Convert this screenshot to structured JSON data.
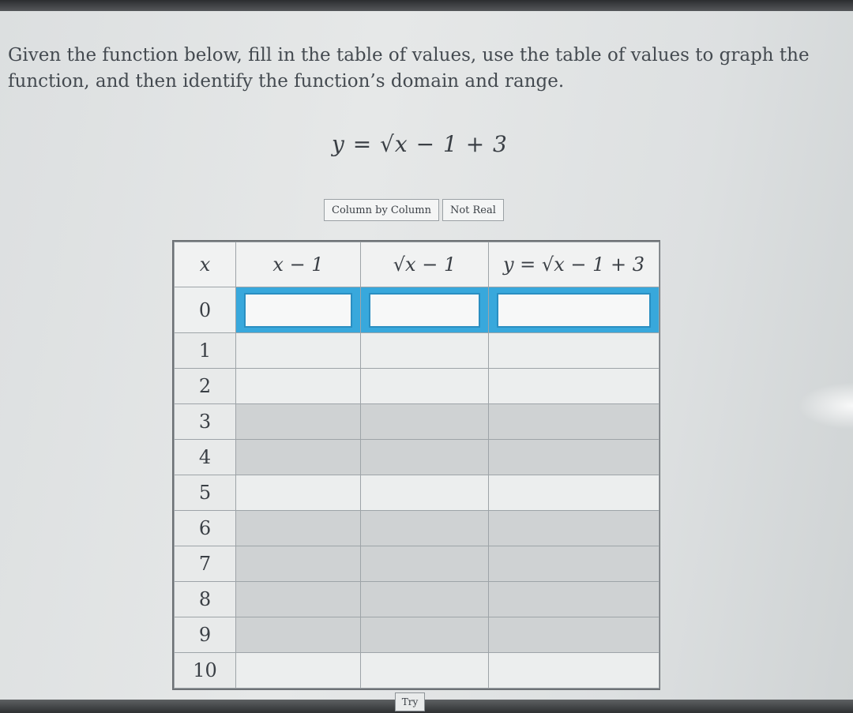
{
  "instructions": "Given the function below, fill in the table of values, use the table of values to graph the function, and then identify the function’s domain and range.",
  "equation": "y = √x − 1 + 3",
  "mode_buttons": [
    "Column by Column",
    "Not Real"
  ],
  "table": {
    "headers": [
      "x",
      "x − 1",
      "√x − 1",
      "y = √x − 1 + 3"
    ],
    "x_values": [
      "0",
      "1",
      "2",
      "3",
      "4",
      "5",
      "6",
      "7",
      "8",
      "9",
      "10"
    ]
  },
  "try_label": "Try"
}
